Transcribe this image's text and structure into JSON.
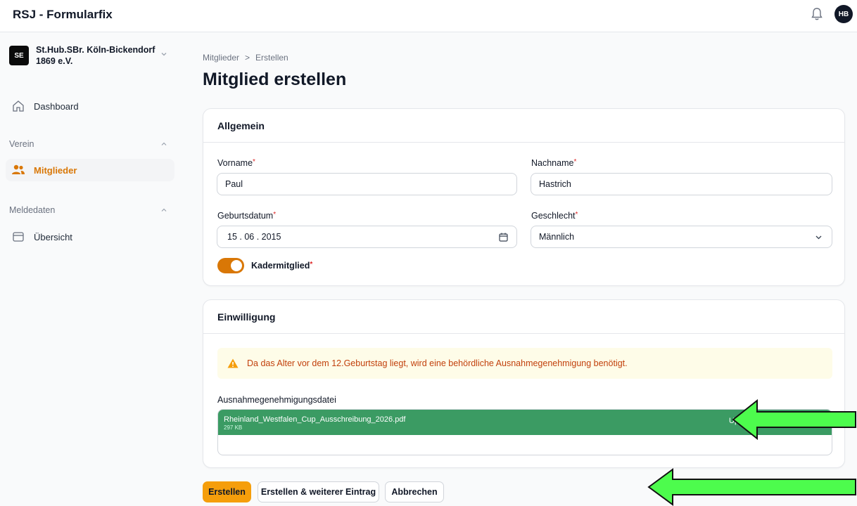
{
  "app": {
    "title": "RSJ - Formularfix",
    "avatar_initials": "HB"
  },
  "tenant": {
    "badge": "SE",
    "name": "St.Hub.SBr. Köln-Bickendorf 1869 e.V."
  },
  "sidebar": {
    "dashboard_label": "Dashboard",
    "group_verein": "Verein",
    "mitglieder_label": "Mitglieder",
    "group_meldedaten": "Meldedaten",
    "uebersicht_label": "Übersicht"
  },
  "breadcrumb": {
    "parent": "Mitglieder",
    "separator": ">",
    "current": "Erstellen"
  },
  "page_title": "Mitglied erstellen",
  "section_general": {
    "title": "Allgemein",
    "first_name_label": "Vorname",
    "first_name_value": "Paul",
    "last_name_label": "Nachname",
    "last_name_value": "Hastrich",
    "birthdate_label": "Geburtsdatum",
    "birthdate_value": "15 . 06 . 2015",
    "gender_label": "Geschlecht",
    "gender_value": "Männlich",
    "squad_label": "Kadermitglied",
    "squad_enabled": true,
    "required_marker": "*"
  },
  "section_consent": {
    "title": "Einwilligung",
    "warning_text": "Da das Alter vor dem 12.Geburtstag liegt, wird eine behördliche Ausnahmegenehmigung benötigt.",
    "file_label": "Ausnahmegenehmigungsdatei",
    "file_name": "Rheinland_Westfalen_Cup_Ausschreibung_2026.pdf",
    "file_size": "297 KB",
    "file_status": "Up"
  },
  "actions": {
    "create": "Erstellen",
    "create_another": "Erstellen & weiterer Eintrag",
    "cancel": "Abbrechen"
  },
  "colors": {
    "accent": "#d97706",
    "button_primary": "#f59e0b",
    "upload_success": "#3b9b63",
    "arrow": "#4dfc4d"
  }
}
